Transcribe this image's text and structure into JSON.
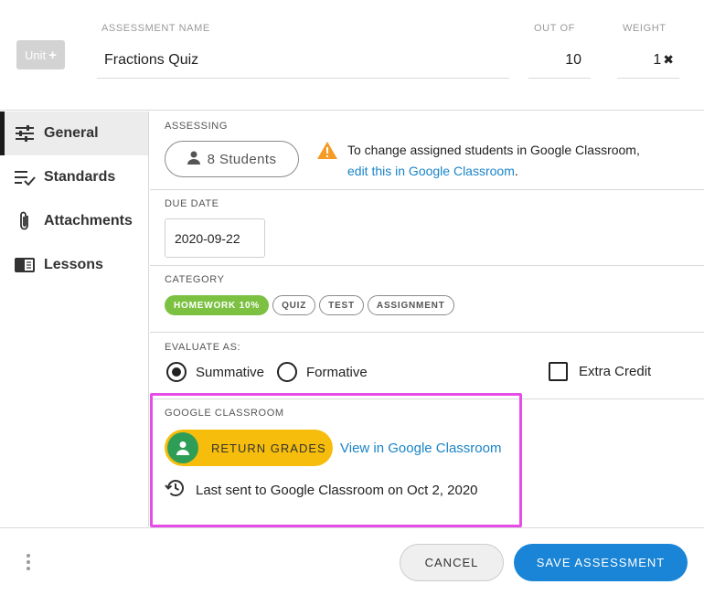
{
  "header": {
    "unit_button": "Unit",
    "name_label": "ASSESSMENT NAME",
    "name_value": "Fractions Quiz",
    "out_of_label": "OUT OF",
    "out_of_value": "10",
    "weight_label": "WEIGHT",
    "weight_value": "1"
  },
  "sidebar": {
    "items": [
      {
        "label": "General",
        "icon": "sliders-icon",
        "active": true
      },
      {
        "label": "Standards",
        "icon": "list-check-icon",
        "active": false
      },
      {
        "label": "Attachments",
        "icon": "paperclip-icon",
        "active": false
      },
      {
        "label": "Lessons",
        "icon": "book-icon",
        "active": false
      }
    ]
  },
  "assessing": {
    "label": "ASSESSING",
    "students_button": "8 Students",
    "warning_text": "To change assigned students in Google Classroom,",
    "warning_link": "edit this in Google Classroom",
    "warning_suffix": "."
  },
  "due_date": {
    "label": "DUE DATE",
    "value": "2020-09-22"
  },
  "category": {
    "label": "CATEGORY",
    "chips": [
      "HOMEWORK 10%",
      "QUIZ",
      "TEST",
      "ASSIGNMENT"
    ],
    "selected": "HOMEWORK 10%"
  },
  "evaluate": {
    "label": "EVALUATE AS:",
    "summative": "Summative",
    "formative": "Formative",
    "selected": "Summative",
    "extra_credit": "Extra Credit"
  },
  "google_classroom": {
    "label": "GOOGLE CLASSROOM",
    "return_button": "RETURN GRADES",
    "view_link": "View in Google Classroom",
    "last_sent": "Last sent to Google Classroom on Oct 2, 2020"
  },
  "footer": {
    "cancel": "CANCEL",
    "save": "SAVE ASSESSMENT"
  },
  "colors": {
    "primary": "#1a84d6",
    "link": "#1a84c7",
    "category_selected": "#7cc142",
    "return_button": "#f7bd0c",
    "classroom_logo": "#2e9e57",
    "warning": "#f59a23",
    "highlight": "#e64ce6"
  }
}
